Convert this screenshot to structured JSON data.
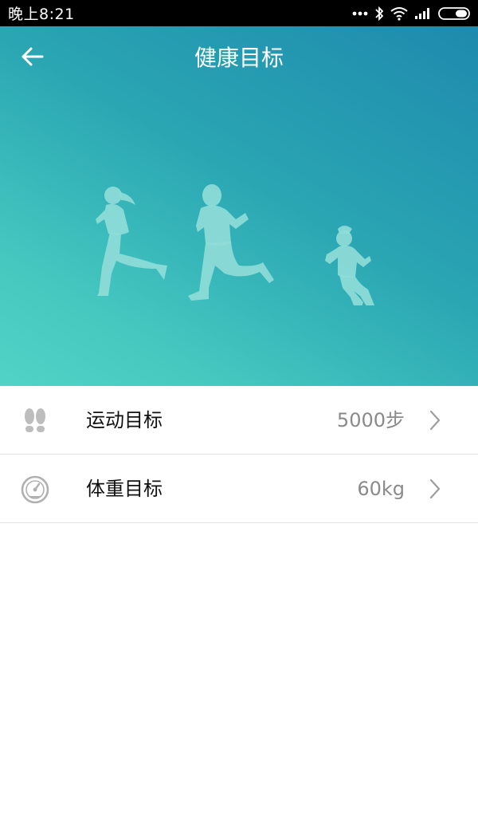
{
  "status_bar": {
    "time": "晚上8:21",
    "icons": [
      "more-dots-icon",
      "bluetooth-icon",
      "wifi-icon",
      "signal-icon",
      "battery-icon"
    ]
  },
  "header": {
    "title": "健康目标",
    "back_icon": "arrow-left-icon"
  },
  "hero": {
    "gradient_colors": [
      "#1e8aae",
      "#2aa6b3",
      "#46c8c0",
      "#52d3c6"
    ],
    "illustration": "runners-silhouette"
  },
  "goals": [
    {
      "label": "运动目标",
      "value": "5000步",
      "icon": "footprints-icon"
    },
    {
      "label": "体重目标",
      "value": "60kg",
      "icon": "scale-icon"
    }
  ],
  "colors": {
    "title_text": "#ffffff",
    "label_text": "#111111",
    "value_text": "#8a8a8a",
    "divider": "#e3e3e3"
  }
}
